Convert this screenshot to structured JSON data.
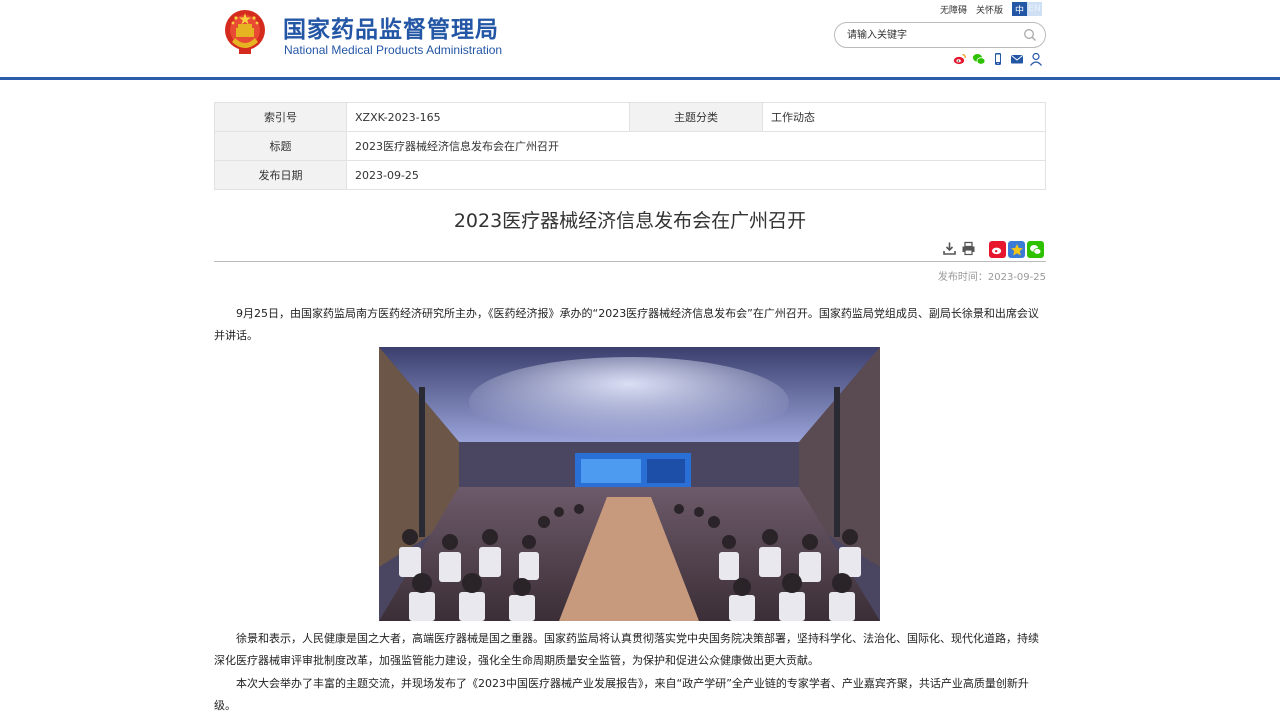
{
  "header": {
    "logo_cn": "国家药品监督管理局",
    "logo_en": "National Medical Products Administration",
    "links": {
      "accessible": "无障碍",
      "elder": "关怀版"
    },
    "lang": {
      "zh": "中",
      "en": "EN"
    },
    "search": {
      "placeholder": "请输入关键字",
      "value": ""
    },
    "socials": [
      "weibo-icon",
      "wechat-icon",
      "mobile-icon",
      "mail-icon",
      "user-icon"
    ]
  },
  "meta": {
    "index_label": "索引号",
    "index_value": "XZXK-2023-165",
    "category_label": "主题分类",
    "category_value": "工作动态",
    "title_label": "标题",
    "title_value": "2023医疗器械经济信息发布会在广州召开",
    "date_label": "发布日期",
    "date_value": "2023-09-25"
  },
  "article": {
    "title": "2023医疗器械经济信息发布会在广州召开",
    "publish_time": "发布时间：2023-09-25",
    "paragraph1": "9月25日，由国家药监局南方医药经济研究所主办，《医药经济报》承办的“2023医疗器械经济信息发布会”在广州召开。国家药监局党组成员、副局长徐景和出席会议并讲话。",
    "paragraph2": "徐景和表示，人民健康是国之大者，高端医疗器械是国之重器。国家药监局将认真贯彻落实党中央国务院决策部署，坚持科学化、法治化、国际化、现代化道路，持续深化医疗器械审评审批制度改革，加强监管能力建设，强化全生命周期质量安全监管，为保护和促进公众健康做出更大贡献。",
    "paragraph3": "本次大会举办了丰富的主题交流，并现场发布了《2023中国医疗器械产业发展报告》，来自“政产学研”全产业链的专家学者、产业嘉宾齐聚，共话产业高质量创新升级。"
  },
  "colors": {
    "brand": "#2456a6",
    "header_line": "#2a5caa",
    "weibo": "#e6162d",
    "favorite": "#f5a623",
    "wechat": "#2dc100"
  }
}
